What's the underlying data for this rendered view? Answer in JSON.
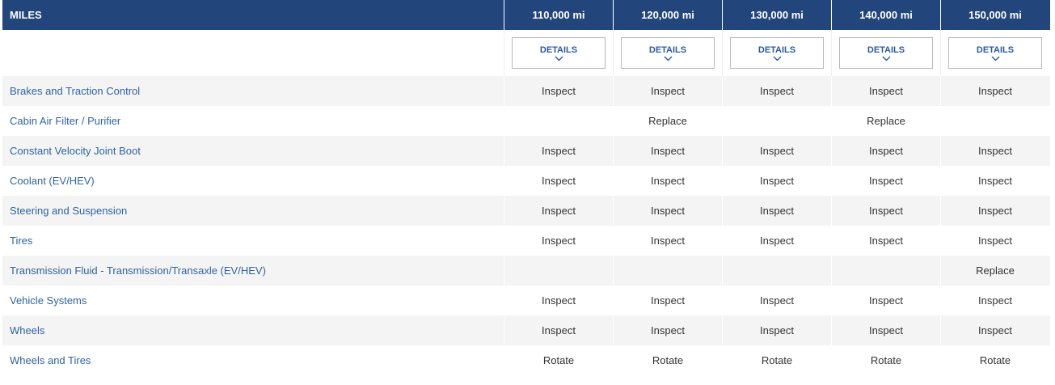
{
  "header": {
    "first_col": "MILES",
    "mileages": [
      "110,000 mi",
      "120,000 mi",
      "130,000 mi",
      "140,000 mi",
      "150,000 mi"
    ]
  },
  "details_label": "DETAILS",
  "rows": [
    {
      "item": "Brakes and Traction Control",
      "values": [
        "Inspect",
        "Inspect",
        "Inspect",
        "Inspect",
        "Inspect"
      ]
    },
    {
      "item": "Cabin Air Filter / Purifier",
      "values": [
        "",
        "Replace",
        "",
        "Replace",
        ""
      ]
    },
    {
      "item": "Constant Velocity Joint Boot",
      "values": [
        "Inspect",
        "Inspect",
        "Inspect",
        "Inspect",
        "Inspect"
      ]
    },
    {
      "item": "Coolant (EV/HEV)",
      "values": [
        "Inspect",
        "Inspect",
        "Inspect",
        "Inspect",
        "Inspect"
      ]
    },
    {
      "item": "Steering and Suspension",
      "values": [
        "Inspect",
        "Inspect",
        "Inspect",
        "Inspect",
        "Inspect"
      ]
    },
    {
      "item": "Tires",
      "values": [
        "Inspect",
        "Inspect",
        "Inspect",
        "Inspect",
        "Inspect"
      ]
    },
    {
      "item": "Transmission Fluid - Transmission/Transaxle (EV/HEV)",
      "values": [
        "",
        "",
        "",
        "",
        "Replace"
      ]
    },
    {
      "item": "Vehicle Systems",
      "values": [
        "Inspect",
        "Inspect",
        "Inspect",
        "Inspect",
        "Inspect"
      ]
    },
    {
      "item": "Wheels",
      "values": [
        "Inspect",
        "Inspect",
        "Inspect",
        "Inspect",
        "Inspect"
      ]
    },
    {
      "item": "Wheels and Tires",
      "values": [
        "Rotate",
        "Rotate",
        "Rotate",
        "Rotate",
        "Rotate"
      ]
    }
  ],
  "colors": {
    "header_bg": "#22457b",
    "link": "#2f63a2",
    "row_shade": "#f4f4f4"
  },
  "icons": {
    "details_toggle": "chevron-down-icon"
  }
}
